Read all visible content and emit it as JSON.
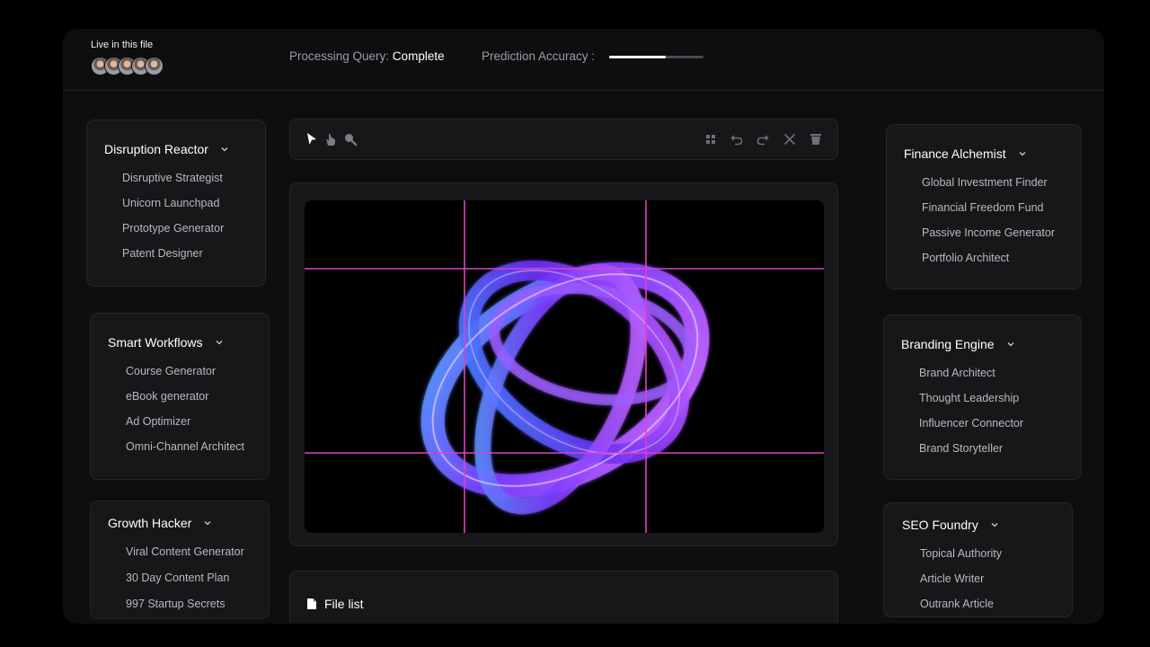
{
  "header": {
    "live_label": "Live in this file",
    "avatars": [
      "avatar-1",
      "avatar-2",
      "avatar-3",
      "avatar-4",
      "avatar-5"
    ],
    "query_label": "Processing Query:",
    "query_value": "Complete",
    "accuracy_label": "Prediction Accuracy :",
    "accuracy_value": 0.6
  },
  "panels_left": [
    {
      "title": "Disruption Reactor",
      "items": [
        "Disruptive Strategist",
        "Unicorn Launchpad",
        "Prototype Generator",
        "Patent Designer"
      ]
    },
    {
      "title": "Smart Workflows",
      "items": [
        "Course Generator",
        "eBook generator",
        "Ad Optimizer",
        "Omni-Channel Architect"
      ]
    },
    {
      "title": "Growth Hacker",
      "items": [
        "Viral Content Generator",
        "30 Day Content Plan",
        "997 Startup Secrets"
      ]
    }
  ],
  "panels_right": [
    {
      "title": "Finance Alchemist",
      "items": [
        "Global Investment Finder",
        "Financial Freedom Fund",
        "Passive Income Generator",
        "Portfolio Architect"
      ]
    },
    {
      "title": "Branding Engine",
      "items": [
        "Brand Architect",
        "Thought Leadership",
        "Influencer Connector",
        "Brand Storyteller"
      ]
    },
    {
      "title": "SEO Foundry",
      "items": [
        "Topical Authority",
        "Article Writer",
        "Outrank Article"
      ]
    }
  ],
  "toolbar": {
    "left_tools": [
      "pointer-icon",
      "hand-icon",
      "zoom-icon"
    ],
    "right_tools": [
      "grid-icon",
      "undo-icon",
      "redo-icon",
      "close-icon",
      "trash-icon"
    ]
  },
  "file_list": {
    "title": "File list",
    "icon": "file-icon"
  },
  "colors": {
    "accent_guides": "#e040c8",
    "shape": "#7b3cff",
    "background": "#000000"
  }
}
